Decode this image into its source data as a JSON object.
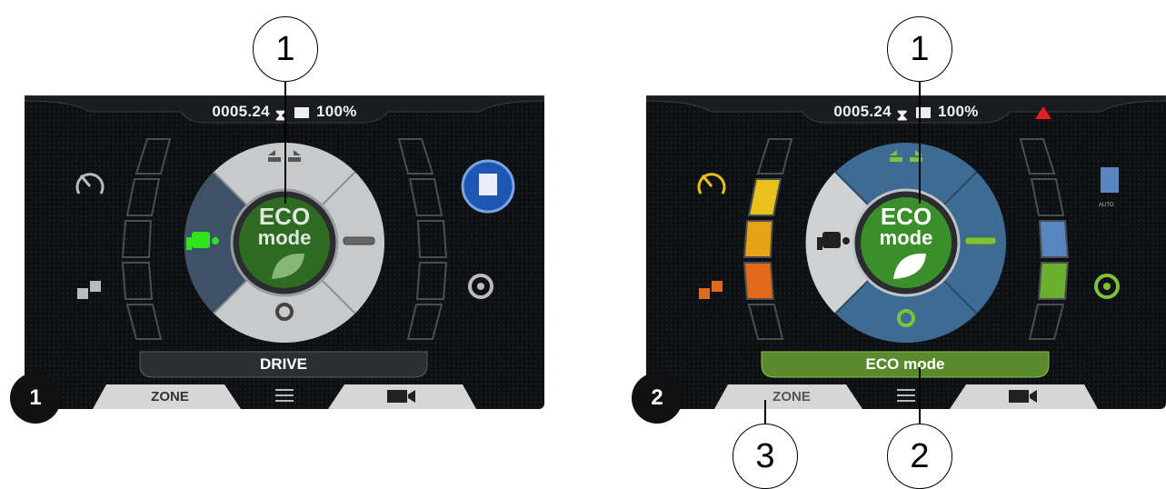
{
  "panels": [
    {
      "hour_meter": "0005.24",
      "battery": "100%",
      "mode_label": "DRIVE",
      "nav": {
        "zone": "ZONE"
      },
      "badge": "1",
      "center": {
        "line1": "ECO",
        "line2": "mode"
      }
    },
    {
      "hour_meter": "0005.24",
      "battery": "100%",
      "mode_label": "ECO mode",
      "nav": {
        "zone": "ZONE"
      },
      "badge": "2",
      "center": {
        "line1": "ECO",
        "line2": "mode"
      },
      "auto_label": "AUTO"
    }
  ],
  "callouts": [
    "1",
    "1",
    "3",
    "2"
  ],
  "colors": {
    "eco_green": "#3a8f2a",
    "active_green": "#7fc23a",
    "mode_bar_green": "#5a8a2e",
    "warning_red": "#e02020",
    "gauge_yellow": "#e8c21a",
    "gauge_orange": "#e06a1a",
    "gauge_blue": "#5a86c0",
    "gauge_green": "#6ab02c",
    "dial_blue": "#3d6b94"
  },
  "icons": [
    "speed-limit-icon",
    "load-weight-icon",
    "operator-icon",
    "hydraulic-icon",
    "turbo-icon",
    "lift-icon",
    "cooling-fan-icon",
    "menu-icon",
    "camera-icon",
    "hourglass-icon",
    "battery-icon",
    "warning-icon",
    "leaf-icon"
  ]
}
